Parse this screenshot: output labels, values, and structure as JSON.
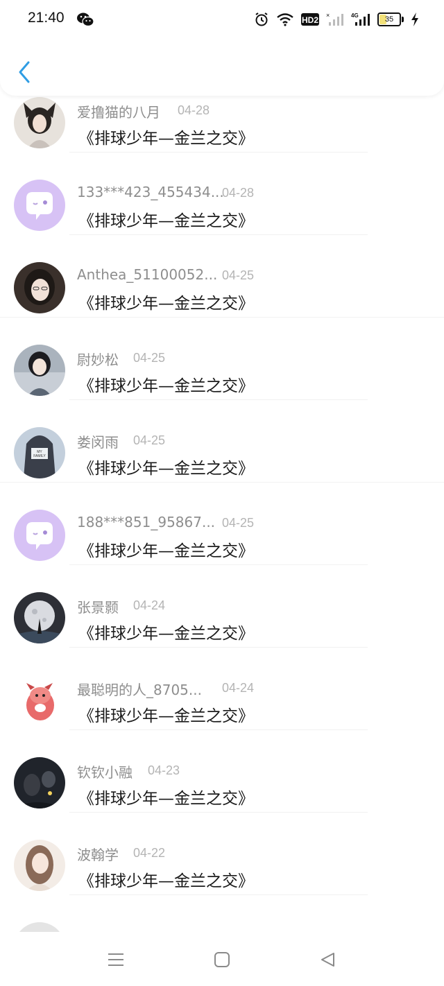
{
  "status_bar": {
    "time": "21:40",
    "network_label": "4G",
    "hd_label": "HD2",
    "battery_percent": "35",
    "battery_level": 0.35,
    "icons": [
      "wechat-icon",
      "alarm-icon",
      "wifi-icon",
      "hd-icon",
      "no-signal-icon",
      "cellular-signal-icon",
      "battery-icon",
      "charging-icon"
    ]
  },
  "header": {
    "back_icon": "chevron-left-icon"
  },
  "comments": [
    {
      "name": "爱撸猫的八月",
      "date": "04-28",
      "content": "《排球少年—金兰之交》",
      "avatar": "photo-cat-ear-girl"
    },
    {
      "name": "133***423_455434...",
      "date": "04-28",
      "content": "《排球少年—金兰之交》",
      "avatar": "default-chat-bubble"
    },
    {
      "name": "Anthea_51100052...",
      "date": "04-25",
      "content": "《排球少年—金兰之交》",
      "avatar": "photo-girl"
    },
    {
      "name": "尉妙松",
      "date": "04-25",
      "content": "《排球少年—金兰之交》",
      "avatar": "photo-girl-keyboard"
    },
    {
      "name": "娄闵雨",
      "date": "04-25",
      "content": "《排球少年—金兰之交》",
      "avatar": "photo-my-family"
    },
    {
      "name": "188***851_95867...",
      "date": "04-25",
      "content": "《排球少年—金兰之交》",
      "avatar": "default-chat-bubble"
    },
    {
      "name": "张景颢",
      "date": "04-24",
      "content": "《排球少年—金兰之交》",
      "avatar": "photo-moon"
    },
    {
      "name": "最聪明的人_8705...",
      "date": "04-24",
      "content": "《排球少年—金兰之交》",
      "avatar": "cartoon-pink-dog"
    },
    {
      "name": "钦钦小融",
      "date": "04-23",
      "content": "《排球少年—金兰之交》",
      "avatar": "photo-couple-night"
    },
    {
      "name": "波翰学",
      "date": "04-22",
      "content": "《排球少年—金兰之交》",
      "avatar": "photo-girl-long-hair"
    }
  ],
  "colors": {
    "accent": "#2f9de4",
    "name_text": "#8e8e8e",
    "date_text": "#b4b4b4",
    "content_text": "#1a1a1a",
    "default_avatar_bg": "#d7c2f5"
  },
  "nav_bar": {
    "icons": [
      "menu-icon",
      "home-square-icon",
      "back-triangle-icon"
    ]
  }
}
